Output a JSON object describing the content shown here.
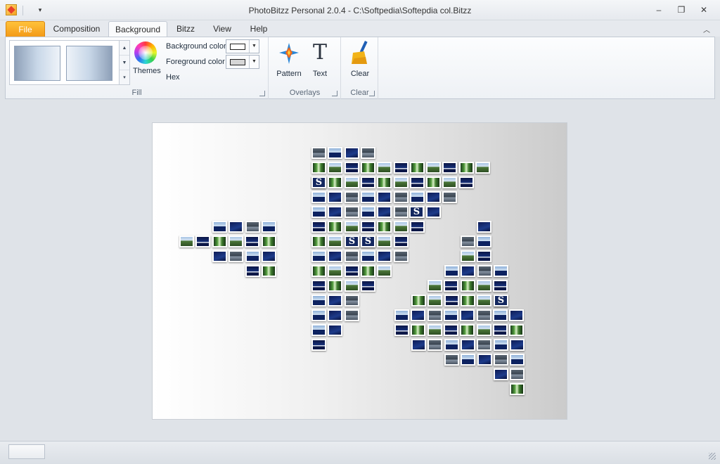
{
  "window": {
    "title": "PhotoBitzz Personal 2.0.4 - C:\\Softpedia\\Softepdia col.Bitzz",
    "buttons": {
      "minimize": "–",
      "restore": "❐",
      "close": "✕"
    },
    "qat_dropdown": "▾"
  },
  "tabs": [
    {
      "label": "File"
    },
    {
      "label": "Composition"
    },
    {
      "label": "Background"
    },
    {
      "label": "Bitzz"
    },
    {
      "label": "View"
    },
    {
      "label": "Help"
    }
  ],
  "ribbon": {
    "minimize_glyph": "︿",
    "fill": {
      "label": "Fill",
      "themes_label": "Themes",
      "background_color_label": "Background color",
      "foreground_color_label": "Foreground color",
      "hex_label": "Hex",
      "gallery_scroll": [
        "▲",
        "▼",
        "▾"
      ],
      "dropdown_arrow": "▼"
    },
    "overlays": {
      "label": "Overlays",
      "pattern_label": "Pattern",
      "text_label": "Text",
      "text_glyph": "T"
    },
    "clear": {
      "label": "Clear",
      "clear_label": "Clear"
    }
  },
  "thumb_S": "S",
  "colors": {
    "file_tab": "#f39a18",
    "accent": "#1e395b",
    "canvas_light": "#ffffff",
    "canvas_dark": "#cbcbcb"
  }
}
